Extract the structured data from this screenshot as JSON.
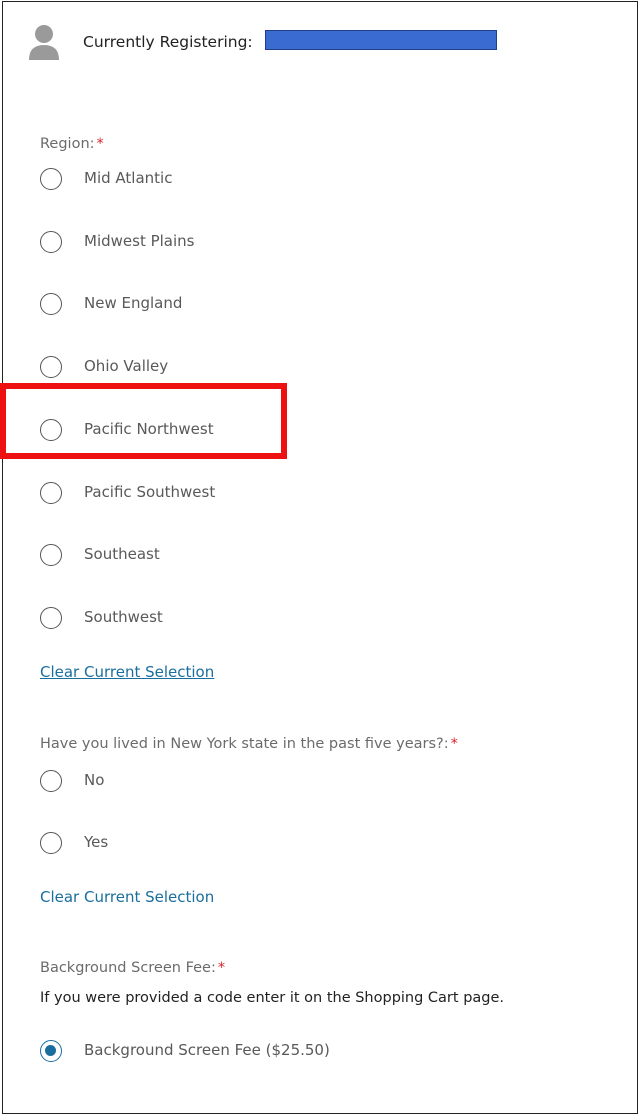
{
  "header": {
    "title": "Currently Registering:"
  },
  "region": {
    "label": "Region:",
    "required_mark": "*",
    "options": [
      "Mid Atlantic",
      "Midwest Plains",
      "New England",
      "Ohio Valley",
      "Pacific Northwest",
      "Pacific Southwest",
      "Southeast",
      "Southwest"
    ],
    "selected": null,
    "clear_link": "Clear Current Selection"
  },
  "ny": {
    "label": "Have you lived in New York state in the past five years?:",
    "required_mark": "*",
    "options": [
      "No",
      "Yes"
    ],
    "selected": null,
    "clear_link": "Clear Current Selection"
  },
  "fee": {
    "label": "Background Screen Fee:",
    "required_mark": "*",
    "note": "If you were provided a code enter it on the Shopping Cart page.",
    "option": "Background Screen Fee ($25.50)",
    "selected": true
  },
  "colors": {
    "link": "#1a6e9e",
    "required": "#d6262b",
    "highlight": "#ee1111",
    "redaction": "#3a6bd1"
  }
}
